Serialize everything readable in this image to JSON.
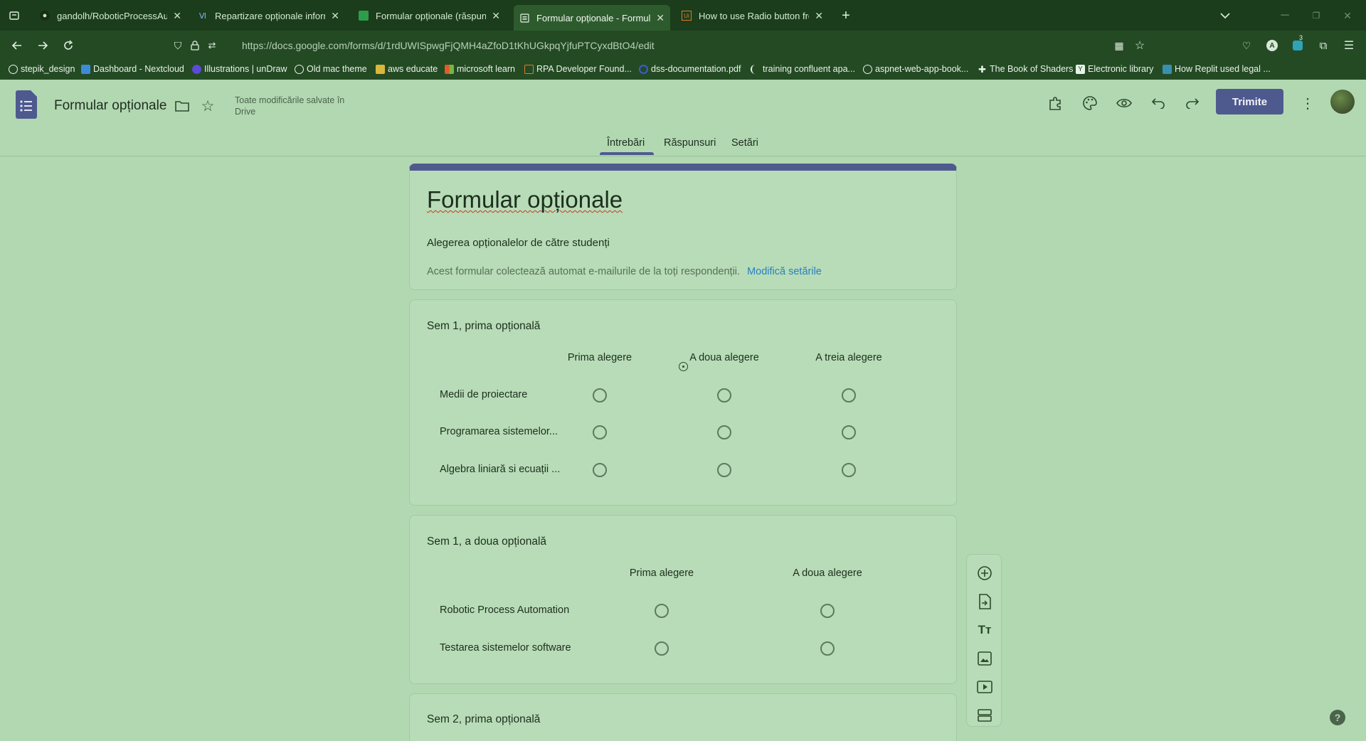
{
  "browser": {
    "tabs": [
      {
        "title": "gandolh/RoboticProcessAutom",
        "icon": "github-icon"
      },
      {
        "title": "Repartizare opționale informati",
        "icon": "forms-icon"
      },
      {
        "title": "Formular opționale (răspunsuri",
        "icon": "sheets-icon"
      },
      {
        "title": "Formular opționale - Formulare",
        "icon": "forms-icon",
        "active": true
      },
      {
        "title": "How to use Radio button from",
        "icon": "uipath-icon"
      }
    ],
    "url": "https://docs.google.com/forms/d/1rdUWISpwgFjQMH4aZfoD1tKhUGkpqYjfuPTCyxdBtO4/edit",
    "extension_badge": "3",
    "bookmarks": [
      "stepik_design",
      "Dashboard - Nextcloud",
      "Illustrations | unDraw",
      "Old mac theme",
      "aws educate",
      "microsoft learn",
      "RPA Developer Found...",
      "dss-documentation.pdf",
      "training confluent apa...",
      "aspnet-web-app-book...",
      "The Book of Shaders",
      "Electronic library",
      "How Replit used legal ..."
    ]
  },
  "app": {
    "doc_title": "Formular opționale",
    "save_status_line1": "Toate modificările salvate în",
    "save_status_line2": "Drive",
    "send_label": "Trimite",
    "tabs": [
      "Întrebări",
      "Răspunsuri",
      "Setări"
    ],
    "active_tab": "Întrebări"
  },
  "form": {
    "title": "Formular opționale",
    "description": "Alegerea opționalelor de către studenți",
    "email_notice": "Acest formular colectează automat e-mailurile de la toți respondenții.",
    "settings_link": "Modifică setările"
  },
  "questions": [
    {
      "title": "Sem 1, prima opțională",
      "columns": [
        "Prima alegere",
        "A doua alegere",
        "A treia alegere"
      ],
      "rows": [
        "Medii de proiectare",
        "Programarea sistemelor...",
        "Algebra liniară si ecuații ..."
      ]
    },
    {
      "title": "Sem 1, a doua opțională",
      "columns": [
        "Prima alegere",
        "A doua alegere"
      ],
      "rows": [
        "Robotic Process Automation",
        "Testarea sistemelor software"
      ]
    },
    {
      "title": "Sem 2, prima opțională"
    }
  ],
  "colors": {
    "theme_bg": "#b2d8b2",
    "accent": "#4e5a8e",
    "link": "#2a7fbf"
  }
}
